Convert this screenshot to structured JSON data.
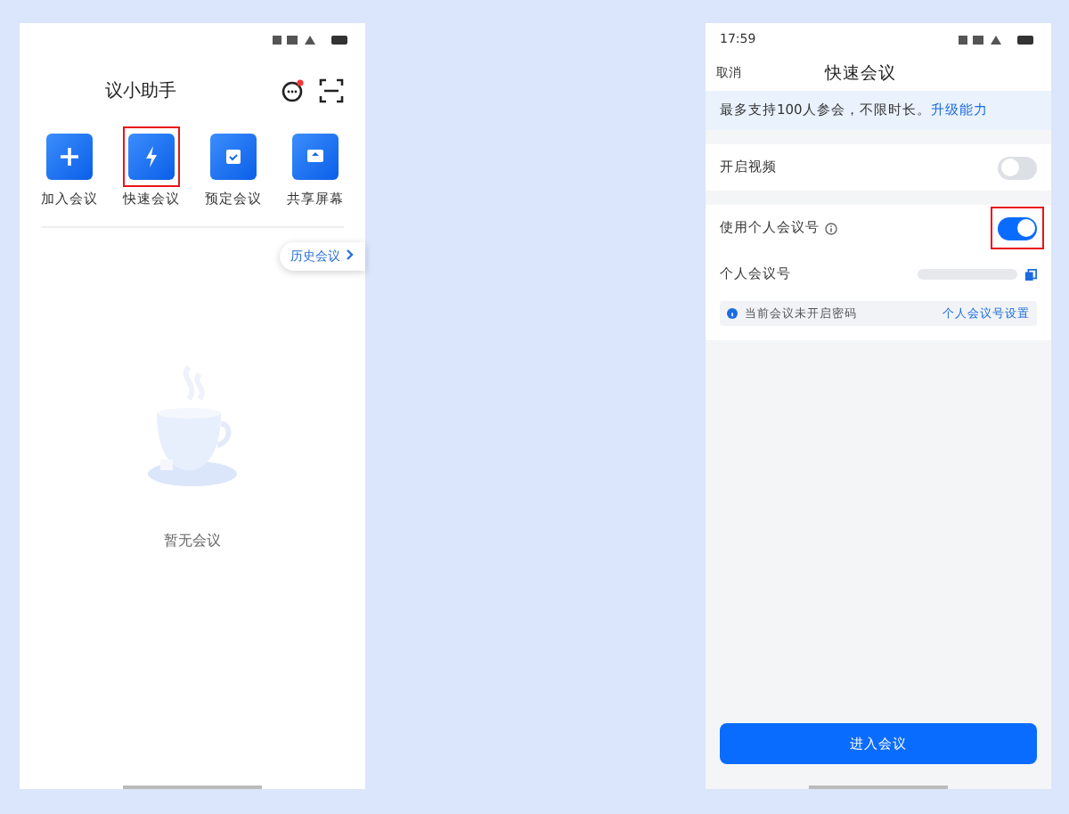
{
  "home_screen": {
    "title": "议小助手",
    "has_unread": true,
    "actions": [
      {
        "label": "加入会议",
        "kind": "plus",
        "highlighted": false
      },
      {
        "label": "快速会议",
        "kind": "bolt",
        "highlighted": true
      },
      {
        "label": "预定会议",
        "kind": "calendar",
        "highlighted": false
      },
      {
        "label": "共享屏幕",
        "kind": "share",
        "highlighted": false
      }
    ],
    "history_button": "历史会议",
    "empty_text": "暂无会议"
  },
  "quick_meeting": {
    "time": "17:59",
    "cancel": "取消",
    "title": "快速会议",
    "notice": "最多支持100人参会，不限时长。",
    "notice_link": "升级能力",
    "toggles": [
      {
        "label": "开启视频",
        "on": false,
        "info": false,
        "highlighted": false
      },
      {
        "label": "使用个人会议号",
        "on": true,
        "info": true,
        "highlighted": true
      }
    ],
    "personal_number_label": "个人会议号",
    "tip": "当前会议未开启密码",
    "tip_link": "个人会议号设置",
    "enter_button": "进入会议"
  }
}
